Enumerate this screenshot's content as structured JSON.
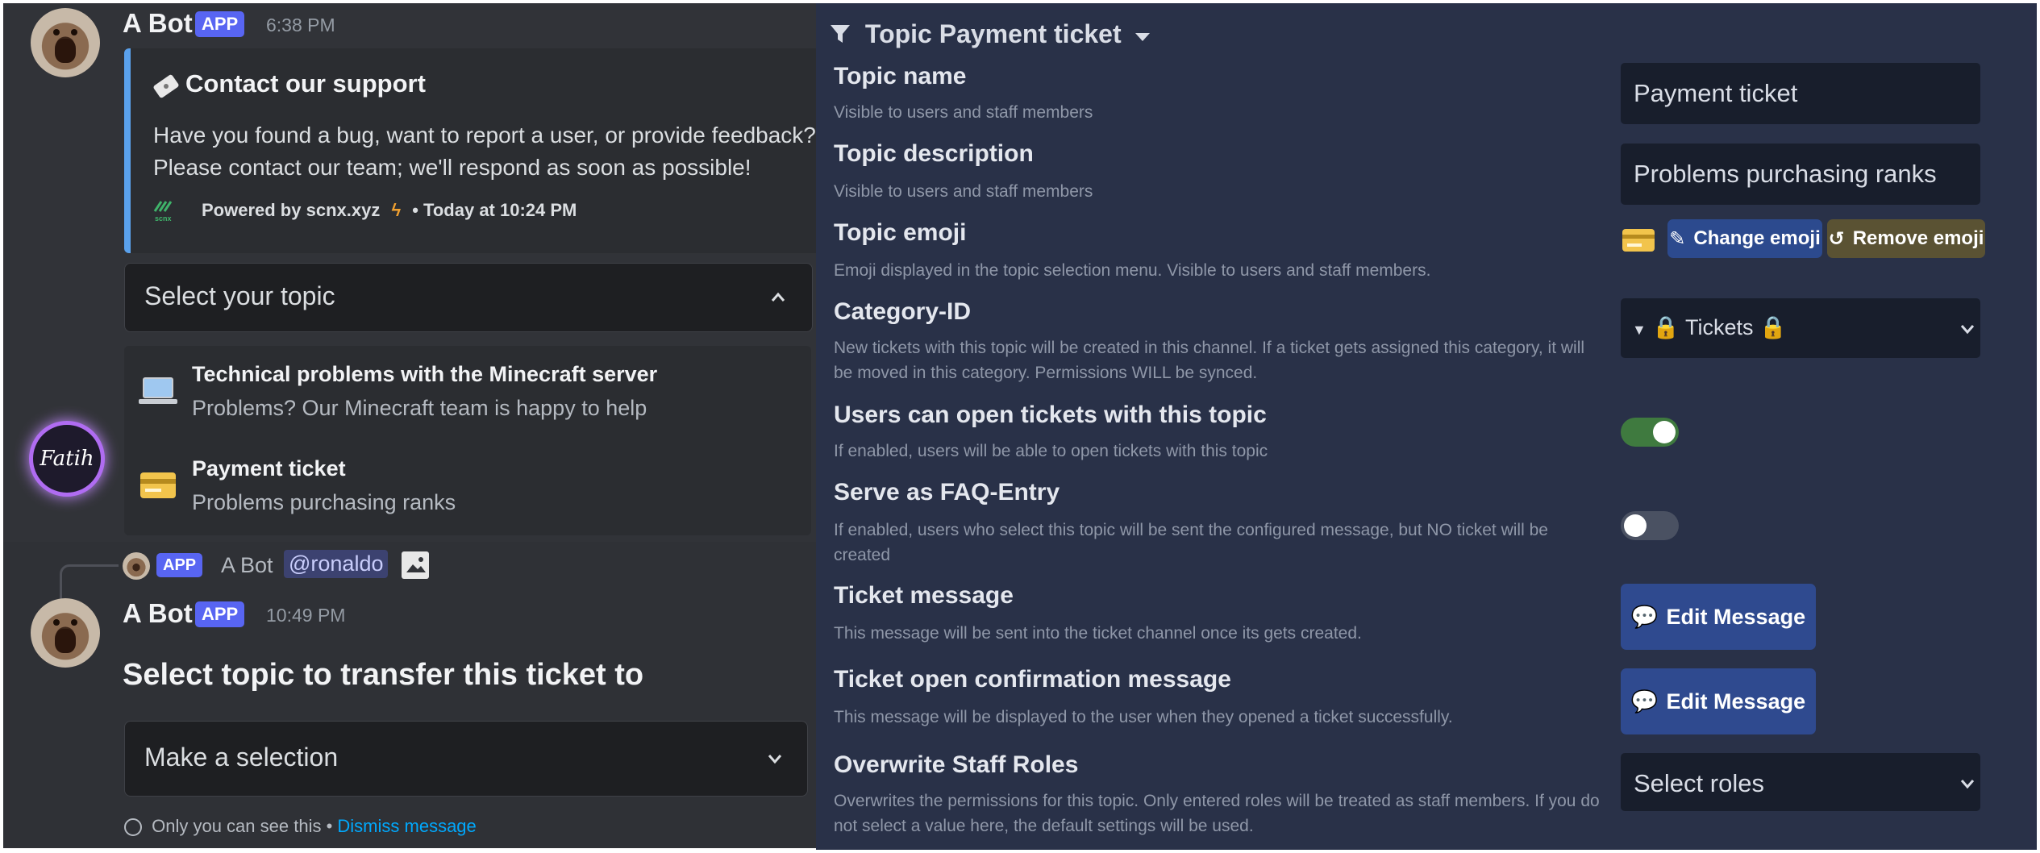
{
  "discord": {
    "msg1": {
      "author": "A Bot",
      "badge": "APP",
      "time": "6:38 PM",
      "embed": {
        "title": "Contact our support",
        "description": "Have you found a bug, want to report a user, or provide feedback?\nPlease contact our team; we'll respond as soon as possible!",
        "footer": "Powered by scnx.xyz",
        "footer_time": "• Today at 10:24 PM",
        "footer_logo": "scnx"
      },
      "select_placeholder": "Select your topic",
      "options": [
        {
          "title": "Technical problems with the Minecraft server",
          "desc": "Problems? Our Minecraft team is happy to help",
          "icon": "laptop-icon"
        },
        {
          "title": "Payment ticket",
          "desc": "Problems purchasing ranks",
          "icon": "credit-card-icon"
        }
      ],
      "signature": "Fatih"
    },
    "reply": {
      "badge": "APP",
      "author": "A Bot",
      "mention": "@ronaldo"
    },
    "msg2": {
      "author": "A Bot",
      "badge": "APP",
      "time": "10:49 PM",
      "heading": "Select topic to transfer this ticket to",
      "select_placeholder": "Make a selection",
      "ephemeral": "Only you can see this •",
      "dismiss": "Dismiss message"
    }
  },
  "settings": {
    "header": "Topic Payment ticket",
    "rows": {
      "name": {
        "title": "Topic name",
        "help": "Visible to users and staff members",
        "value": "Payment ticket"
      },
      "description": {
        "title": "Topic description",
        "help": "Visible to users and staff members",
        "value": "Problems purchasing ranks"
      },
      "emoji": {
        "title": "Topic emoji",
        "help": "Emoji displayed in the topic selection menu. Visible to users and staff members.",
        "change_label": "Change emoji",
        "remove_label": "Remove emoji"
      },
      "category": {
        "title": "Category-ID",
        "help": "New tickets with this topic will be created in this channel. If a ticket gets assigned this category, it will be moved in this category. Permissions WILL be synced.",
        "value": "Tickets"
      },
      "users_open": {
        "title": "Users can open tickets with this topic",
        "help": "If enabled, users will be able to open tickets with this topic",
        "enabled": true
      },
      "faq": {
        "title": "Serve as FAQ-Entry",
        "help": "If enabled, users who select this topic will be sent the configured message, but NO ticket will be created",
        "enabled": false
      },
      "ticket_msg": {
        "title": "Ticket message",
        "help": "This message will be sent into the ticket channel once its gets created.",
        "button": "Edit Message"
      },
      "confirm_msg": {
        "title": "Ticket open confirmation message",
        "help": "This message will be displayed to the user when they opened a ticket successfully.",
        "button": "Edit Message"
      },
      "staff_roles": {
        "title": "Overwrite Staff Roles",
        "help": "Overwrites the permissions for this topic. Only entered roles will be treated as staff members. If you do not select a value here, the default settings will be used.",
        "placeholder": "Select roles"
      }
    }
  },
  "colors": {
    "discord_bg": "#313338",
    "blurple": "#5865f2",
    "settings_bg": "#293148",
    "toggle_on": "#3f7a3f",
    "toggle_off": "#4a5162",
    "button_blue": "#2f4a8f"
  }
}
